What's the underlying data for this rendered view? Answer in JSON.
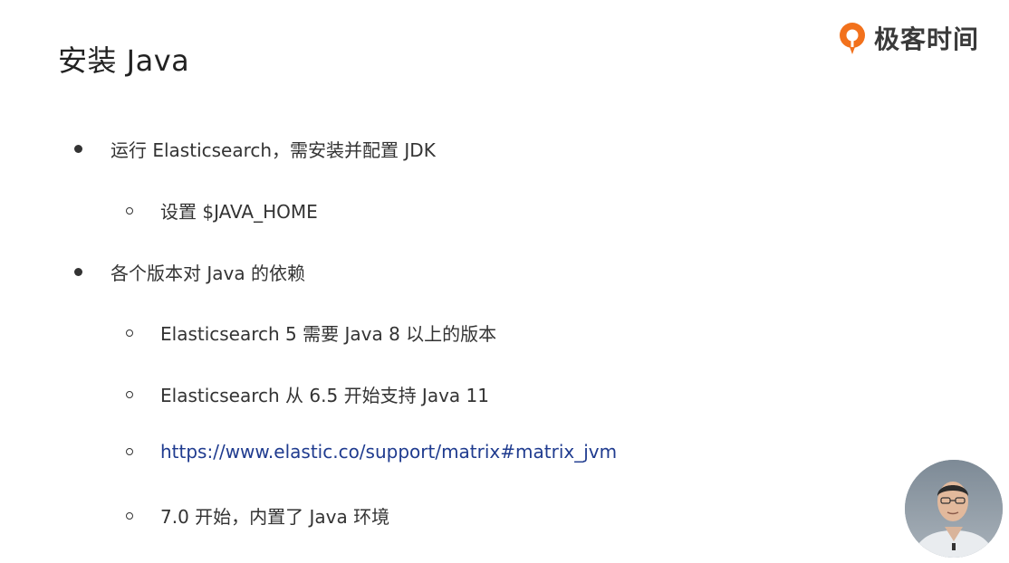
{
  "slide": {
    "title": "安装 Java",
    "logo_text": "极客时间"
  },
  "bullets": [
    {
      "level": 1,
      "text": "运行 Elasticsearch，需安装并配置 JDK"
    },
    {
      "level": 2,
      "text": "设置 $JAVA_HOME"
    },
    {
      "level": 1,
      "text": "各个版本对 Java 的依赖"
    },
    {
      "level": 2,
      "text": "Elasticsearch 5 需要 Java 8 以上的版本"
    },
    {
      "level": 2,
      "text": "Elasticsearch 从 6.5 开始支持 Java 11"
    },
    {
      "level": 2,
      "text": "https://www.elastic.co/support/matrix#matrix_jvm",
      "is_link": true
    },
    {
      "level": 2,
      "text": "7.0 开始，内置了 Java 环境"
    }
  ],
  "colors": {
    "logo_accent": "#f2711c",
    "link": "#1f3b8f",
    "text": "#333333"
  },
  "icons": {
    "logo": "geektime-logo-icon",
    "presenter": "presenter-video-avatar"
  }
}
